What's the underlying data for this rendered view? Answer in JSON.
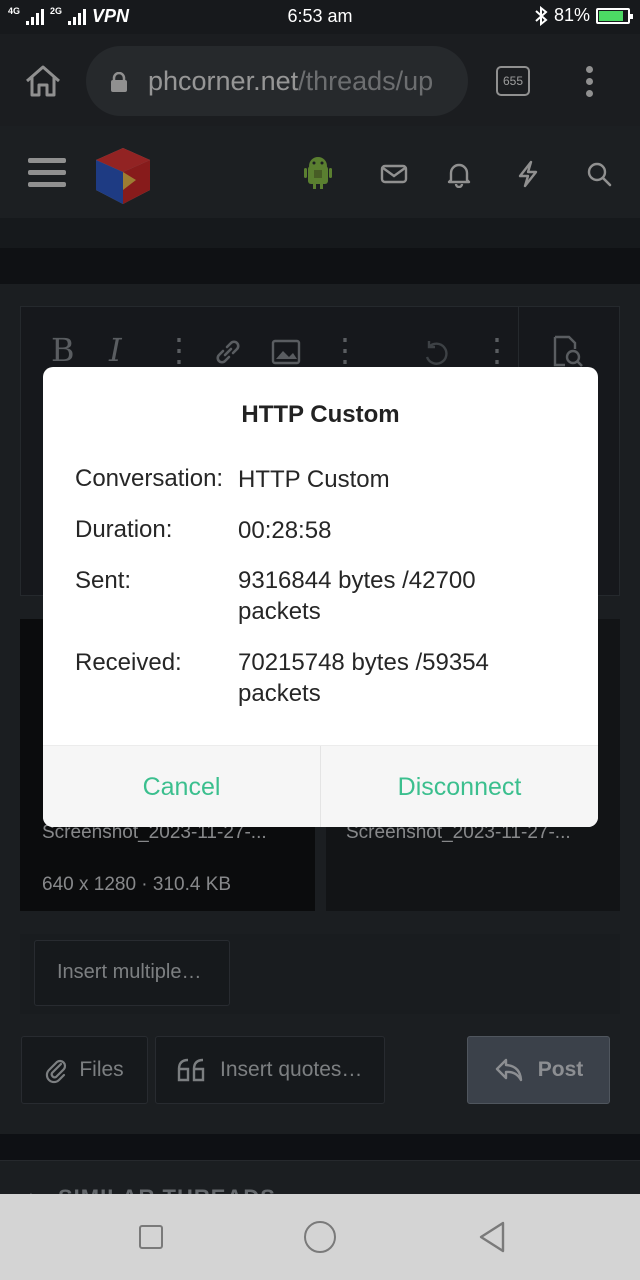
{
  "status_bar": {
    "network_1": "4G",
    "network_2": "2G",
    "vpn": "VPN",
    "time": "6:53 am",
    "battery": "81%",
    "battery_level": 0.81
  },
  "browser": {
    "url_domain": "phcorner.net",
    "url_path": "/threads/up",
    "tab_count": "655"
  },
  "editor": {
    "thumbnails": [
      {
        "name": "Screenshot_2023-11-27-...",
        "meta": "640 x 1280 · 310.4 KB"
      },
      {
        "name": "Screenshot_2023-11-27-...",
        "meta": ""
      }
    ],
    "insert_multiple": "Insert multiple…",
    "files_label": "Files",
    "insert_quotes_label": "Insert quotes…",
    "post_label": "Post"
  },
  "similar_threads": {
    "label": "SIMILAR THREADS"
  },
  "dialog": {
    "title": "HTTP Custom",
    "rows": [
      {
        "label": "Conversation:",
        "value": "HTTP Custom"
      },
      {
        "label": "Duration:",
        "value": "00:28:58"
      },
      {
        "label": "Sent:",
        "value": "9316844 bytes /42700 packets"
      },
      {
        "label": "Received:",
        "value": "70215748 bytes /59354 packets"
      }
    ],
    "cancel_label": "Cancel",
    "disconnect_label": "Disconnect"
  },
  "colors": {
    "accent": "#3bbf8e",
    "dialog_bg": "#ffffff",
    "page_bg": "#2a2e33"
  },
  "icons": [
    "home-icon",
    "lock-icon",
    "menu-kebab-icon",
    "hamburger-icon",
    "android-icon",
    "mail-icon",
    "bell-icon",
    "lightning-icon",
    "search-icon",
    "paperclip-icon",
    "quote-icon",
    "reply-icon"
  ]
}
